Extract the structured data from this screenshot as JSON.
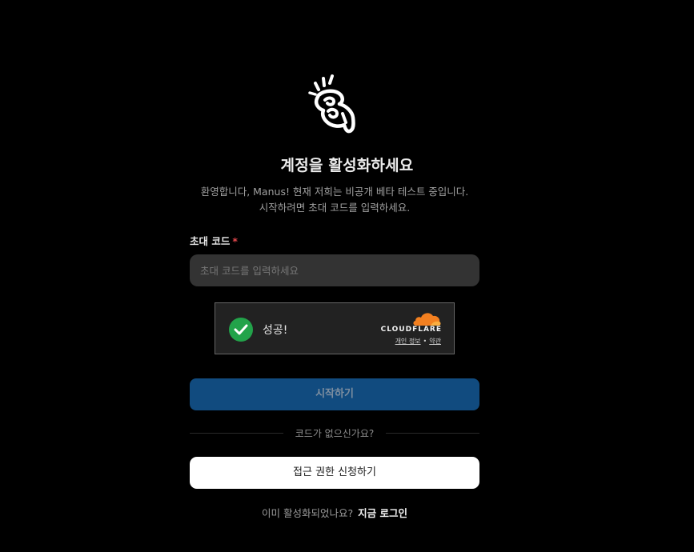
{
  "header": {
    "title": "계정을 활성화하세요",
    "subtitle_line1": "환영합니다, Manus! 현재 저희는 비공개 베타 테스트 중입니다.",
    "subtitle_line2": "시작하려면 초대 코드를 입력하세요."
  },
  "form": {
    "label": "초대 코드",
    "required_mark": "*",
    "input_value": "",
    "input_placeholder": "초대 코드를 입력하세요"
  },
  "captcha": {
    "status": "성공!",
    "brand": "CLOUDFLARE",
    "privacy_link": "개인 정보",
    "separator": "•",
    "terms_link": "약관",
    "colors": {
      "success": "#22a34a",
      "cloud": "#f38020"
    }
  },
  "actions": {
    "start_label": "시작하기",
    "divider_text": "코드가 없으신가요?",
    "request_label": "접근 권한 신청하기"
  },
  "footer": {
    "question": "이미 활성화되었나요?",
    "login_link": "지금 로그인"
  },
  "colors": {
    "background": "#000000",
    "primary_button": "#114b7f",
    "secondary_button": "#ffffff",
    "required": "#e5484d"
  }
}
